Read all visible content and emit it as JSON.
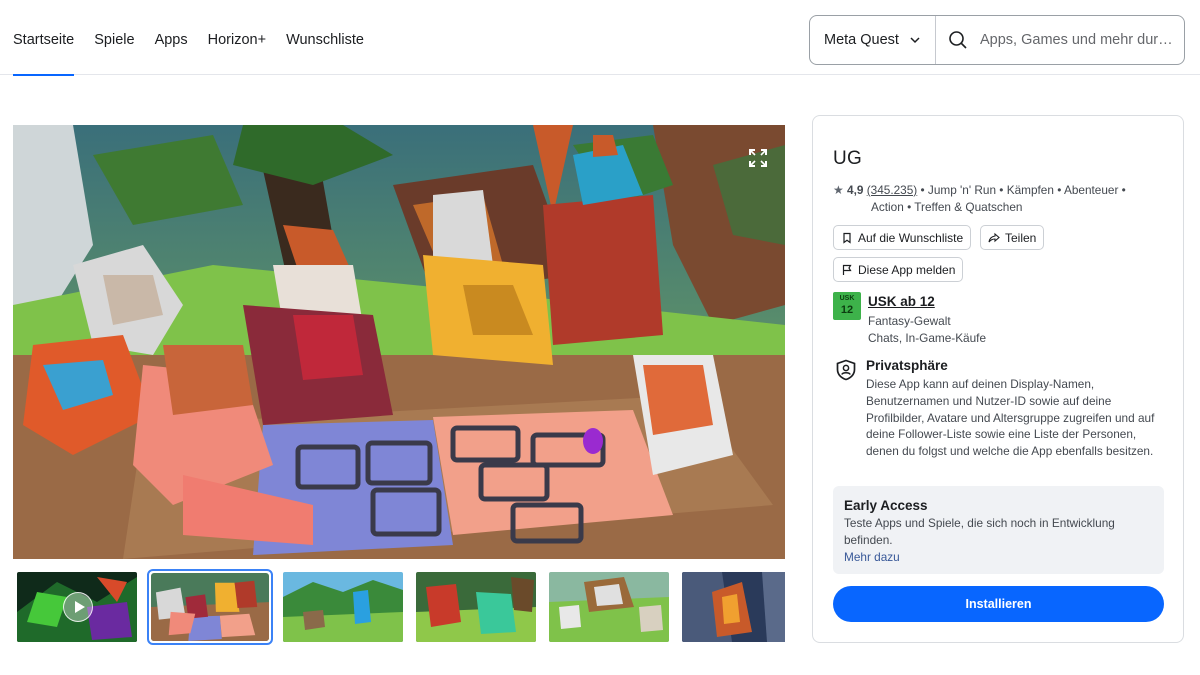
{
  "nav": {
    "items": [
      {
        "label": "Startseite",
        "active": true
      },
      {
        "label": "Spiele",
        "active": false
      },
      {
        "label": "Apps",
        "active": false
      },
      {
        "label": "Horizon+",
        "active": false
      },
      {
        "label": "Wunschliste",
        "active": false
      }
    ],
    "accent_color": "#0866ff"
  },
  "search": {
    "platform_label": "Meta Quest",
    "placeholder": "Apps, Games und mehr durchsuchen",
    "icon": "search-icon"
  },
  "media": {
    "hero_alt": "UG screenshot",
    "expand_icon": "expand-icon",
    "thumbnails": [
      {
        "kind": "video",
        "selected": false,
        "icon": "play-icon"
      },
      {
        "kind": "image",
        "selected": true
      },
      {
        "kind": "image",
        "selected": false
      },
      {
        "kind": "image",
        "selected": false
      },
      {
        "kind": "image",
        "selected": false
      },
      {
        "kind": "image",
        "selected": false
      }
    ]
  },
  "app": {
    "title": "UG",
    "rating": "4,9",
    "rating_count": "(345.235)",
    "genres_line1": "• Jump 'n' Run • Kämpfen • Abenteuer •",
    "genres_line2": "Action • Treffen & Quatschen",
    "wishlist_label": "Auf die Wunschliste",
    "share_label": "Teilen",
    "report_label": "Diese App melden",
    "usk": {
      "badge_top": "USK",
      "badge_num": "12",
      "title": "USK ab 12",
      "desc_line1": "Fantasy-Gewalt",
      "desc_line2": "Chats, In-Game-Käufe",
      "color": "#3db24a"
    },
    "privacy": {
      "title": "Privatsphäre",
      "text": "Diese App kann auf deinen Display-Namen, Benutzernamen und Nutzer-ID sowie auf deine Profilbilder, Avatare und Altersgruppe zugreifen und auf deine Follower-Liste sowie eine Liste der Personen, denen du folgst und welche die App ebenfalls besitzen."
    },
    "early_access": {
      "title": "Early Access",
      "text": "Teste Apps und Spiele, die sich noch in Entwicklung befinden.",
      "link": "Mehr dazu"
    },
    "install_label": "Installieren",
    "install_color": "#0866ff"
  }
}
